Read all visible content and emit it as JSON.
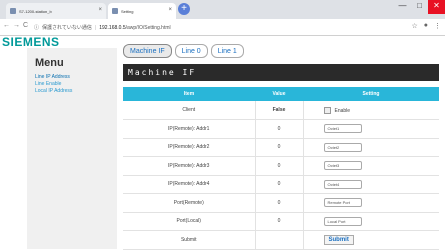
{
  "browser": {
    "tabs": [
      {
        "label": "S7-1200-station_b"
      },
      {
        "label": "Setting"
      }
    ],
    "new_tab_glyph": "+",
    "back_glyph": "←",
    "forward_glyph": "→",
    "reload_glyph": "C",
    "security_label": "保護されていない通信",
    "url_host": "192.168.0.5",
    "url_path": "/awp/IO/Setting.html",
    "window_controls": [
      "—",
      "□",
      "✕"
    ],
    "tab_close_glyph": "×"
  },
  "brand": {
    "logo": "SIEMENS"
  },
  "sidebar": {
    "title": "Menu",
    "links": [
      "Line IP Address",
      "Line Enable",
      "Local IP Address"
    ]
  },
  "tabs": [
    "Machine IF",
    "Line 0",
    "Line 1"
  ],
  "section_title": "Machine IF",
  "table": {
    "headers": [
      "Item",
      "Value",
      "Setting"
    ],
    "client": {
      "item": "Client",
      "value": "False",
      "setting": "Enable"
    },
    "rows": [
      {
        "item": "IP(Remote): Addr1",
        "value": "0",
        "placeholder": "Octet1"
      },
      {
        "item": "IP(Remote): Addr2",
        "value": "0",
        "placeholder": "Octet2"
      },
      {
        "item": "IP(Remote): Addr3",
        "value": "0",
        "placeholder": "Octet3"
      },
      {
        "item": "IP(Remote): Addr4",
        "value": "0",
        "placeholder": "Octet4"
      },
      {
        "item": "Port(Remote)",
        "value": "0",
        "placeholder": "Remote Port"
      },
      {
        "item": "Port(Local)",
        "value": "0",
        "placeholder": "Local Port"
      }
    ],
    "submit": {
      "item": "Submit",
      "button": "Submit"
    }
  },
  "icons": {
    "star": "star-icon",
    "account": "account-icon",
    "menu": "menu-dots-icon"
  },
  "colors": {
    "brand": "#009999",
    "table_header": "#29b6d9",
    "section_header": "#2a2a2a",
    "close": "#e81123"
  }
}
